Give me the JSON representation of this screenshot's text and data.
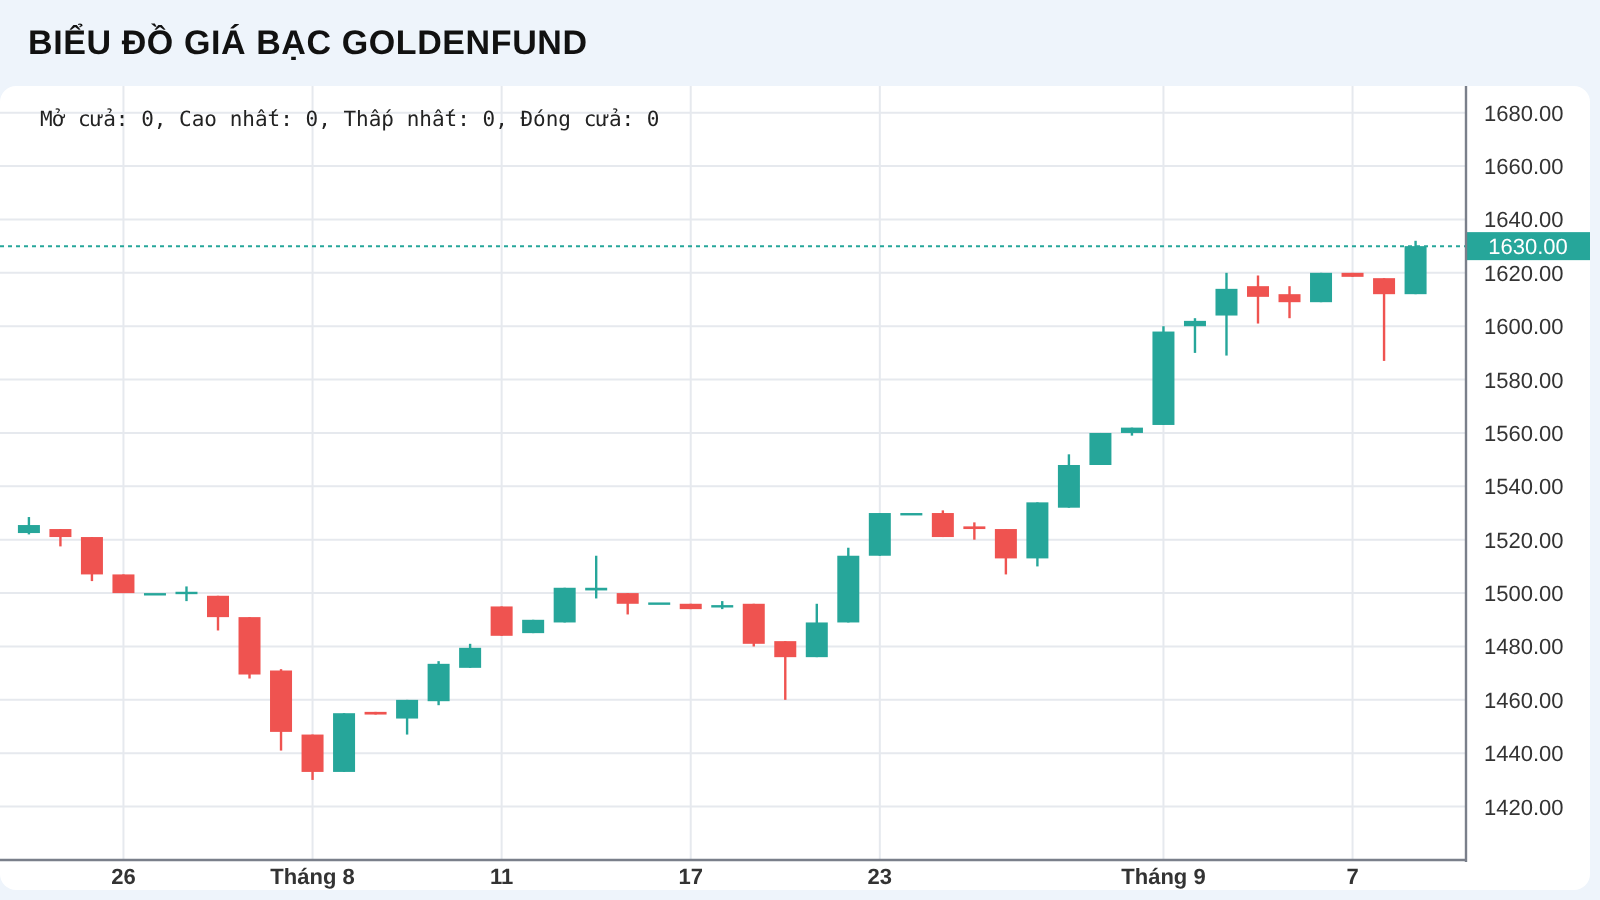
{
  "title": "BIỂU ĐỒ GIÁ BẠC GOLDENFUND",
  "chart": {
    "legend": "Mở cửa: 0, Cao nhất: 0, Thấp nhất: 0, Đóng cửa: 0",
    "chart_data": {
      "type": "candlestick",
      "grid": true,
      "ylim": [
        1400,
        1690
      ],
      "yticks": [
        {
          "value": 1420,
          "label": "1420.00"
        },
        {
          "value": 1440,
          "label": "1440.00"
        },
        {
          "value": 1460,
          "label": "1460.00"
        },
        {
          "value": 1480,
          "label": "1480.00"
        },
        {
          "value": 1500,
          "label": "1500.00"
        },
        {
          "value": 1520,
          "label": "1520.00"
        },
        {
          "value": 1540,
          "label": "1540.00"
        },
        {
          "value": 1560,
          "label": "1560.00"
        },
        {
          "value": 1580,
          "label": "1580.00"
        },
        {
          "value": 1600,
          "label": "1600.00"
        },
        {
          "value": 1620,
          "label": "1620.00"
        },
        {
          "value": 1640,
          "label": "1640.00"
        },
        {
          "value": 1660,
          "label": "1660.00"
        },
        {
          "value": 1680,
          "label": "1680.00"
        }
      ],
      "categories": [
        null,
        null,
        null,
        "26",
        null,
        null,
        null,
        null,
        null,
        "Tháng 8",
        null,
        null,
        null,
        null,
        null,
        "11",
        null,
        null,
        null,
        null,
        null,
        "17",
        null,
        null,
        null,
        null,
        null,
        "23",
        null,
        null,
        null,
        null,
        null,
        null,
        null,
        null,
        "Tháng 9",
        null,
        null,
        null,
        null,
        null,
        "7",
        null,
        null
      ],
      "ohlc": [
        [
          1522.5,
          1528.5,
          1522,
          1525.5
        ],
        [
          1524,
          1524,
          1517.5,
          1521
        ],
        [
          1521,
          1521,
          1504.5,
          1507
        ],
        [
          1507,
          1507,
          1500,
          1500
        ],
        [
          1500,
          1500,
          1500,
          1500
        ],
        [
          1500,
          1502.5,
          1497,
          1500.5
        ],
        [
          1499,
          1499,
          1486,
          1491
        ],
        [
          1491,
          1491,
          1468,
          1469.5
        ],
        [
          1471,
          1471.5,
          1441,
          1448
        ],
        [
          1447,
          1447,
          1430,
          1433
        ],
        [
          1433,
          1455,
          1433,
          1455
        ],
        [
          1455.5,
          1455.5,
          1454.5,
          1454.5
        ],
        [
          1453,
          1460,
          1447,
          1460
        ],
        [
          1459.5,
          1474.5,
          1458,
          1473.5
        ],
        [
          1472,
          1481,
          1472,
          1479.5
        ],
        [
          1495,
          1495,
          1484,
          1484
        ],
        [
          1485,
          1490,
          1485,
          1490
        ],
        [
          1489,
          1502,
          1489,
          1502
        ],
        [
          1501,
          1514,
          1498,
          1502
        ],
        [
          1500,
          1500,
          1492,
          1496
        ],
        [
          1496.5,
          1496.5,
          1496.5,
          1496.5
        ],
        [
          1496,
          1496,
          1494,
          1494
        ],
        [
          1495,
          1497,
          1494,
          1495.5
        ],
        [
          1496,
          1496,
          1480,
          1481
        ],
        [
          1482,
          1482,
          1460,
          1476
        ],
        [
          1476,
          1496,
          1476,
          1489
        ],
        [
          1489,
          1517,
          1489,
          1514
        ],
        [
          1514,
          1530,
          1514,
          1530
        ],
        [
          1530,
          1530,
          1530,
          1530
        ],
        [
          1530,
          1531,
          1521,
          1521
        ],
        [
          1525,
          1526.5,
          1520,
          1524
        ],
        [
          1524,
          1524,
          1507,
          1513
        ],
        [
          1513,
          1534,
          1510,
          1534
        ],
        [
          1532,
          1552,
          1532,
          1548
        ],
        [
          1548,
          1560,
          1548,
          1560
        ],
        [
          1560,
          1562,
          1559,
          1562
        ],
        [
          1563,
          1600,
          1563,
          1598
        ],
        [
          1600,
          1603,
          1590,
          1602
        ],
        [
          1604,
          1620,
          1589,
          1614
        ],
        [
          1615,
          1619,
          1601,
          1611
        ],
        [
          1612,
          1615,
          1603,
          1609
        ],
        [
          1609,
          1620,
          1609,
          1620
        ],
        [
          1620,
          1620,
          1618.5,
          1618.5
        ],
        [
          1618,
          1618,
          1587,
          1612
        ],
        [
          1612,
          1632,
          1612,
          1630
        ]
      ],
      "ref_lines": [
        {
          "axis": "y",
          "value": 1630,
          "label": "1630.00"
        }
      ]
    }
  }
}
